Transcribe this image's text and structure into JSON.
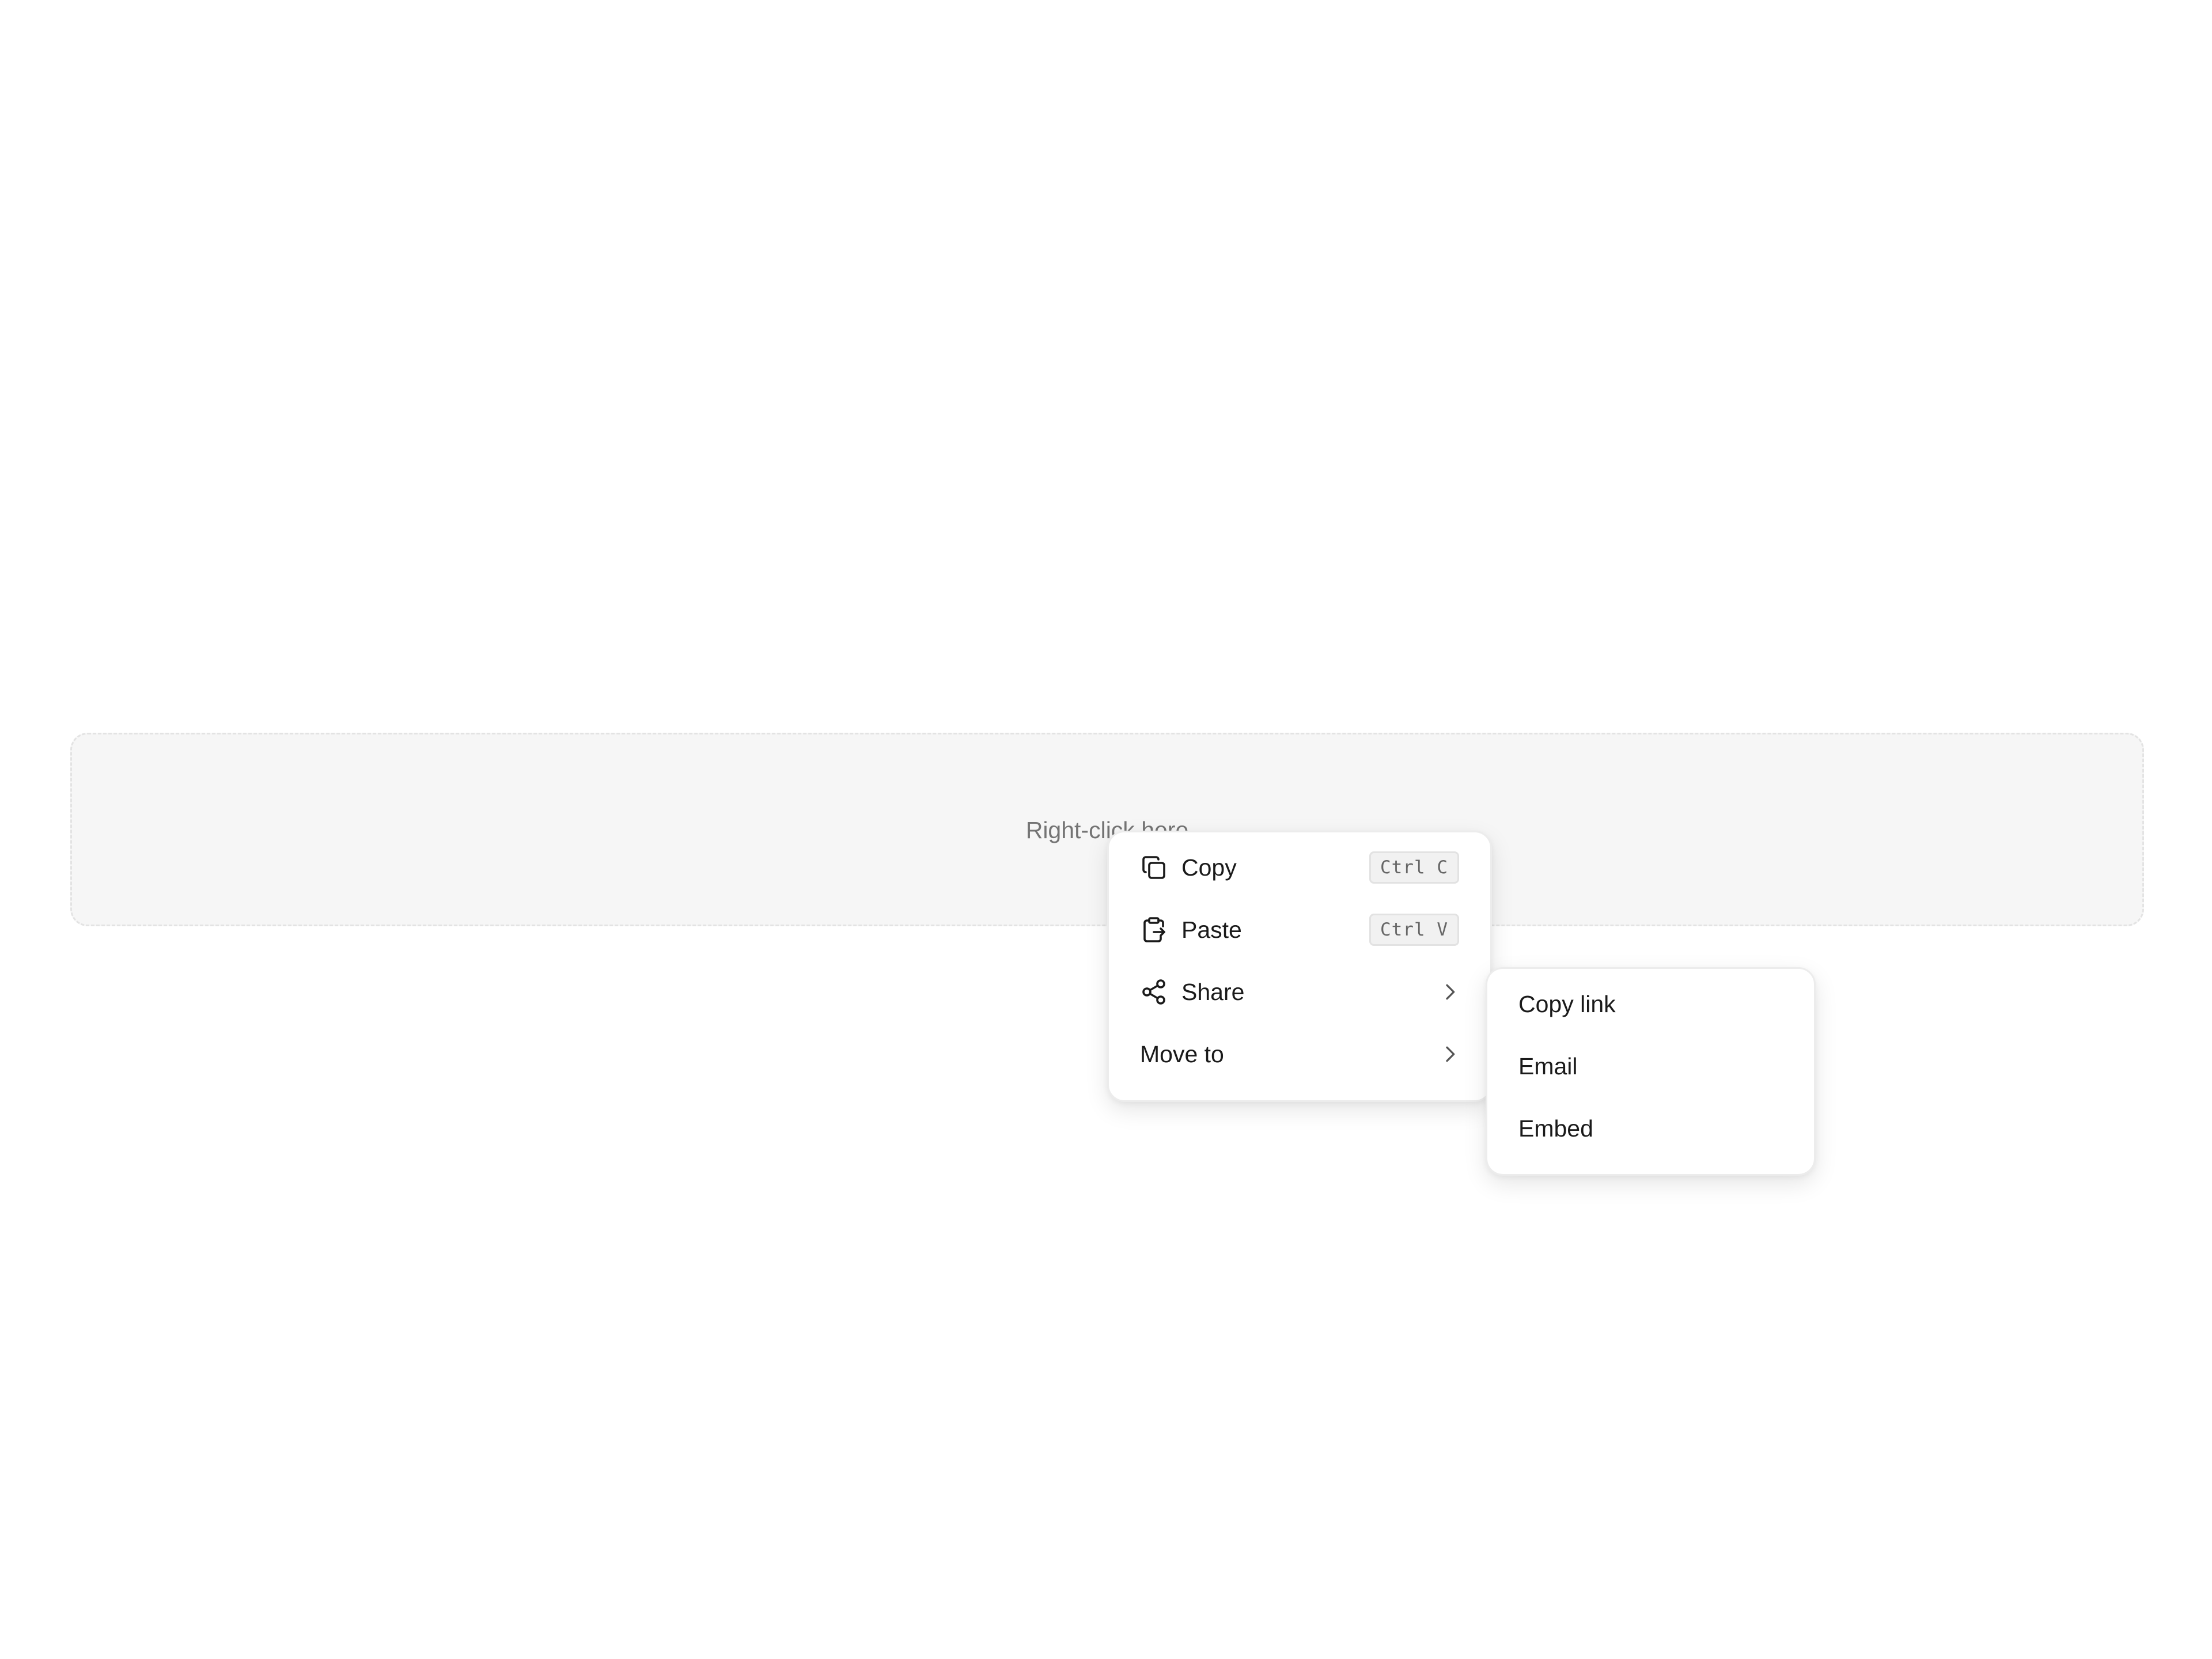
{
  "drop_zone": {
    "hint": "Right-click here"
  },
  "context_menu": {
    "items": [
      {
        "label": "Copy",
        "icon": "copy-icon",
        "shortcut": "Ctrl C"
      },
      {
        "label": "Paste",
        "icon": "paste-icon",
        "shortcut": "Ctrl V"
      },
      {
        "label": "Share",
        "icon": "share-icon",
        "has_submenu": true
      },
      {
        "label": "Move to",
        "has_submenu": true
      }
    ]
  },
  "share_submenu": {
    "items": [
      {
        "label": "Copy link"
      },
      {
        "label": "Email"
      },
      {
        "label": "Embed"
      }
    ]
  }
}
